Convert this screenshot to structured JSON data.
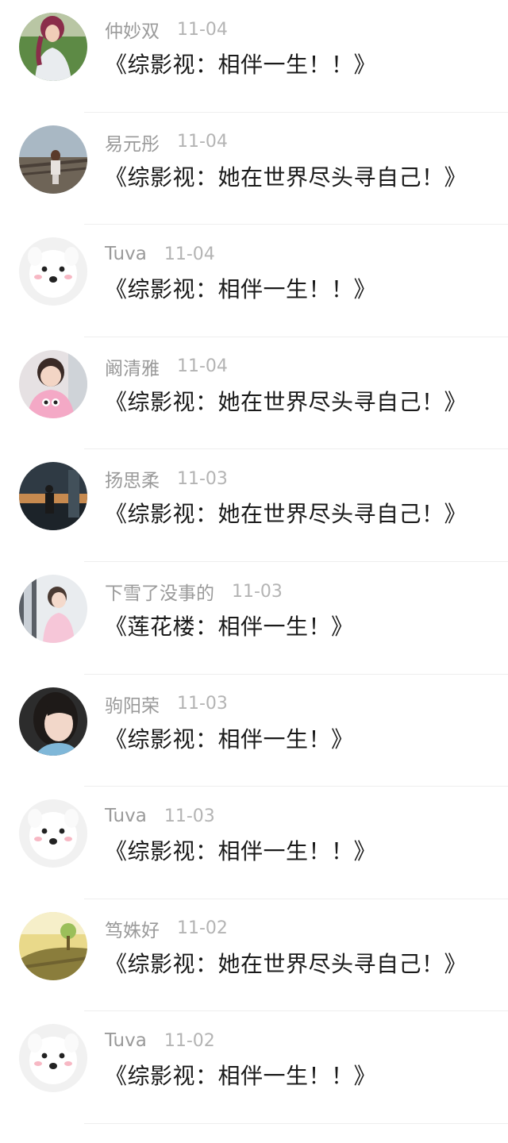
{
  "comments": [
    {
      "name": "仲妙双",
      "time": "11-04",
      "text": "《综影视：相伴一生！！》",
      "avatar_icon": "woman-in-white-dress-icon"
    },
    {
      "name": "易元彤",
      "time": "11-04",
      "text": "《综影视：她在世界尽头寻自己！》",
      "avatar_icon": "child-on-bridge-icon"
    },
    {
      "name": "Tuva",
      "time": "11-04",
      "text": "《综影视：相伴一生！！》",
      "avatar_icon": "white-dog-icon"
    },
    {
      "name": "阚清雅",
      "time": "11-04",
      "text": "《综影视：她在世界尽头寻自己！》",
      "avatar_icon": "girl-pink-sweater-icon"
    },
    {
      "name": "扬思柔",
      "time": "11-03",
      "text": "《综影视：她在世界尽头寻自己！》",
      "avatar_icon": "sunset-person-icon"
    },
    {
      "name": "下雪了没事的",
      "time": "11-03",
      "text": "《莲花楼：相伴一生！》",
      "avatar_icon": "child-at-window-icon"
    },
    {
      "name": "驹阳荣",
      "time": "11-03",
      "text": "《综影视：相伴一生！》",
      "avatar_icon": "girl-portrait-icon"
    },
    {
      "name": "Tuva",
      "time": "11-03",
      "text": "《综影视：相伴一生！！》",
      "avatar_icon": "white-dog-icon"
    },
    {
      "name": "笃姝好",
      "time": "11-02",
      "text": "《综影视：她在世界尽头寻自己！》",
      "avatar_icon": "yellow-landscape-icon"
    },
    {
      "name": "Tuva",
      "time": "11-02",
      "text": "《综影视：相伴一生！！》",
      "avatar_icon": "white-dog-icon"
    }
  ],
  "colors": {
    "name": "#9a9a9a",
    "time": "#b4b4b4",
    "text": "#1a1a1a",
    "divider": "#eeeeee"
  }
}
